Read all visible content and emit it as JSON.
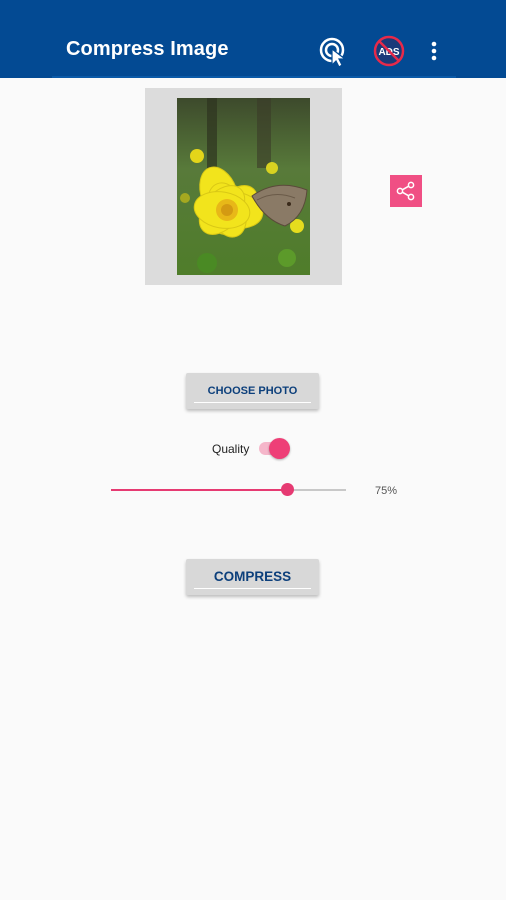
{
  "appbar": {
    "title": "Compress Image",
    "icons": [
      "touch-icon",
      "no-ads-icon",
      "more-vert-icon"
    ],
    "color": "#034a93"
  },
  "image_preview": {
    "description_icon": "photo"
  },
  "share": {
    "icon": "share-icon",
    "color": "#f04f84"
  },
  "choose_button": {
    "label": "CHOOSE PHOTO"
  },
  "quality": {
    "label": "Quality",
    "toggle_on": true,
    "slider_fraction": 0.75,
    "value_text": "75%",
    "accent": "#e63a72"
  },
  "compress_button": {
    "label": "COMPRESS"
  }
}
